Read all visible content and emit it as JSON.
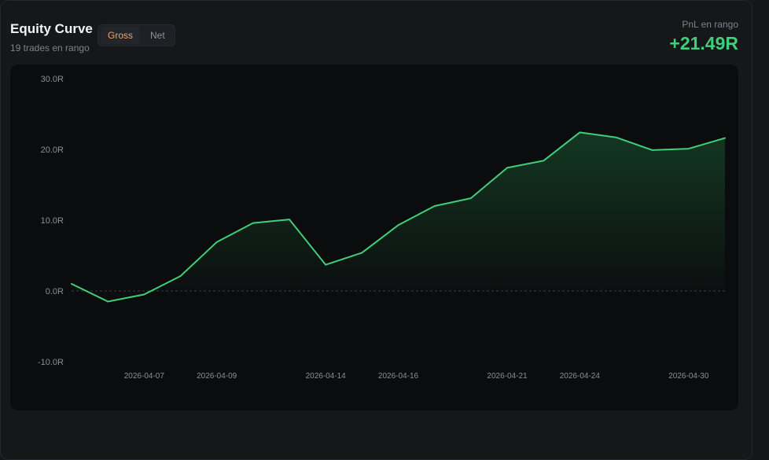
{
  "header": {
    "title": "Equity Curve",
    "subtitle": "19 trades en rango",
    "toggle": {
      "gross_label": "Gross",
      "net_label": "Net",
      "selected": "Gross"
    },
    "pnl_label": "PnL en rango",
    "pnl_value": "+21.49R"
  },
  "colors": {
    "line": "#3fcf7a",
    "accent_active": "#f0a36b",
    "positive": "#3fcf7a"
  },
  "chart_data": {
    "type": "area",
    "title": "Equity Curve",
    "xlabel": "",
    "ylabel": "",
    "ylim": [
      -10,
      30
    ],
    "y_ticks": [
      30,
      20,
      10,
      0,
      -10
    ],
    "y_tick_labels": [
      "30.0R",
      "20.0R",
      "10.0R",
      "0.0R",
      "-10.0R"
    ],
    "x_tick_labels": [
      {
        "index": 2,
        "label": "2026-04-07"
      },
      {
        "index": 4,
        "label": "2026-04-09"
      },
      {
        "index": 7,
        "label": "2026-04-14"
      },
      {
        "index": 9,
        "label": "2026-04-16"
      },
      {
        "index": 12,
        "label": "2026-04-21"
      },
      {
        "index": 14,
        "label": "2026-04-24"
      },
      {
        "index": 17,
        "label": "2026-04-30"
      }
    ],
    "zero_line": true,
    "grid": false,
    "series": [
      {
        "values": [
          1.0,
          -1.5,
          -0.5,
          2.1,
          6.9,
          9.6,
          10.1,
          3.7,
          5.4,
          9.3,
          12.0,
          13.1,
          17.4,
          18.4,
          22.4,
          21.7,
          19.9,
          20.1,
          21.6
        ]
      }
    ]
  }
}
